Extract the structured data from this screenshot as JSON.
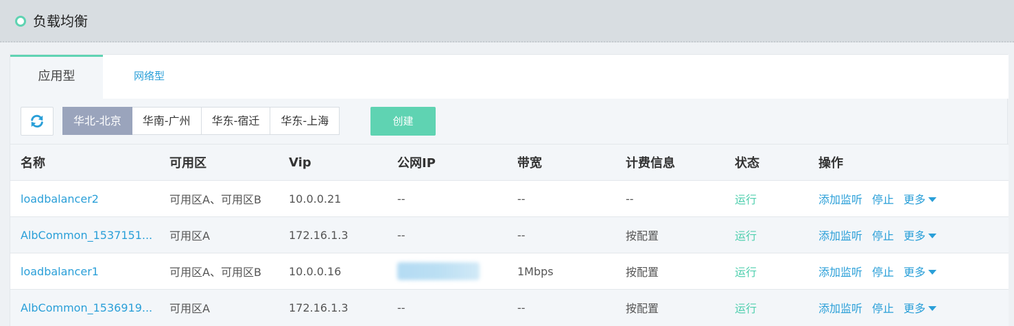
{
  "header": {
    "title": "负载均衡"
  },
  "tabs": [
    {
      "label": "应用型",
      "active": true
    },
    {
      "label": "网络型",
      "active": false
    }
  ],
  "toolbar": {
    "refresh_icon": "refresh-icon",
    "regions": [
      {
        "label": "华北-北京",
        "selected": true
      },
      {
        "label": "华南-广州",
        "selected": false
      },
      {
        "label": "华东-宿迁",
        "selected": false
      },
      {
        "label": "华东-上海",
        "selected": false
      }
    ],
    "create_label": "创建"
  },
  "table": {
    "columns": [
      "名称",
      "可用区",
      "Vip",
      "公网IP",
      "带宽",
      "计费信息",
      "状态",
      "操作"
    ],
    "rows": [
      {
        "name": "loadbalancer2",
        "zone": "可用区A、可用区B",
        "vip": "10.0.0.21",
        "public_ip": "--",
        "bandwidth": "--",
        "billing": "--",
        "status": "运行",
        "ops": [
          "添加监听",
          "停止",
          "更多"
        ]
      },
      {
        "name": "AlbCommon_1537151...",
        "zone": "可用区A",
        "vip": "172.16.1.3",
        "public_ip": "--",
        "bandwidth": "--",
        "billing": "按配置",
        "status": "运行",
        "ops": [
          "添加监听",
          "停止",
          "更多"
        ]
      },
      {
        "name": "loadbalancer1",
        "zone": "可用区A、可用区B",
        "vip": "10.0.0.16",
        "public_ip": "",
        "bandwidth": "1Mbps",
        "billing": "按配置",
        "status": "运行",
        "ops": [
          "添加监听",
          "停止",
          "更多"
        ]
      },
      {
        "name": "AlbCommon_1536919...",
        "zone": "可用区A",
        "vip": "172.16.1.3",
        "public_ip": "--",
        "bandwidth": "--",
        "billing": "按配置",
        "status": "运行",
        "ops": [
          "添加监听",
          "停止",
          "更多"
        ]
      }
    ]
  },
  "colors": {
    "accent": "#5fd3b2",
    "link": "#2a9fd8",
    "selected_region": "#9aa4bc"
  }
}
